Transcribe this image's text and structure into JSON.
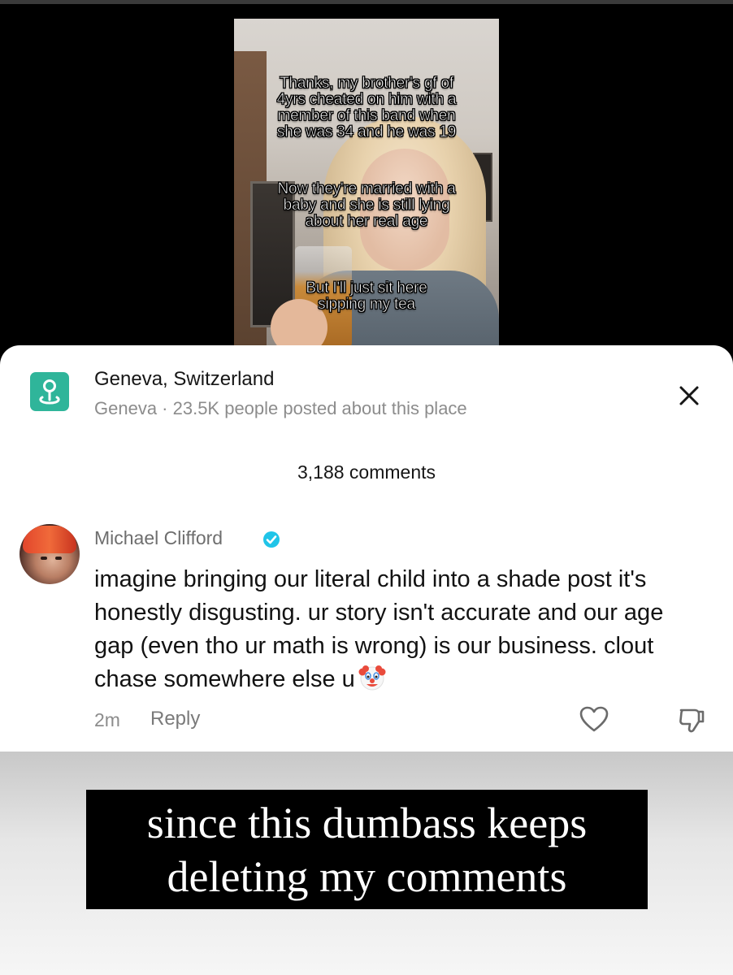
{
  "video": {
    "caption_1": "Thanks, my brother's gf of\n4yrs cheated on him with a\nmember of this band when\nshe was 34 and he was 19",
    "caption_2": "Now they're married with a\nbaby and she is still lying\nabout her real age",
    "caption_3": "But I'll just sit here\nsipping my tea"
  },
  "location": {
    "icon": "location-pin-icon",
    "title": "Geneva, Switzerland",
    "subtitle": "Geneva · 23.5K people posted about this place",
    "accent_color": "#2fb59a"
  },
  "comments_header": {
    "count_label": "3,188 comments"
  },
  "comment": {
    "username": "Michael Clifford",
    "verified": true,
    "text": "imagine bringing our literal child into a shade post it's honestly disgusting. ur story isn't accurate and our age gap (even tho ur math is wrong) is our business. clout chase somewhere else u",
    "emoji": "clown-face-icon",
    "time": "2m",
    "reply_label": "Reply"
  },
  "overlay": {
    "text": "since this dumbass keeps\ndeleting my comments"
  },
  "colors": {
    "verified_blue": "#20c4e8"
  }
}
